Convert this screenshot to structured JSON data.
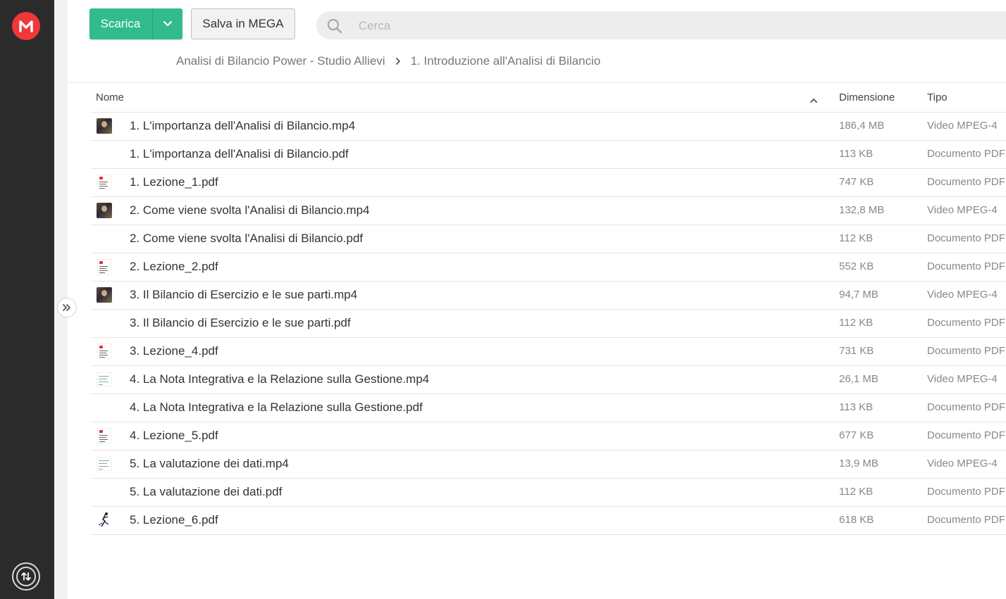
{
  "toolbar": {
    "download_label": "Scarica",
    "save_label": "Salva in MEGA",
    "search_placeholder": "Cerca"
  },
  "breadcrumb": [
    "Analisi di Bilancio Power - Studio Allievi",
    "1. Introduzione all'Analisi di Bilancio"
  ],
  "columns": {
    "name": "Nome",
    "size": "Dimensione",
    "type": "Tipo"
  },
  "files": [
    {
      "name": "1. L'importanza dell'Analisi di Bilancio.mp4",
      "size": "186,4 MB",
      "type": "Video MPEG-4",
      "thumb": "video-thumbnail"
    },
    {
      "name": "1. L'importanza dell'Analisi di Bilancio.pdf",
      "size": "113 KB",
      "type": "Documento PDF",
      "thumb": "none"
    },
    {
      "name": "1. Lezione_1.pdf",
      "size": "747 KB",
      "type": "Documento PDF",
      "thumb": "pdf-thumbnail"
    },
    {
      "name": "2. Come viene svolta l'Analisi di Bilancio.mp4",
      "size": "132,8 MB",
      "type": "Video MPEG-4",
      "thumb": "video-thumbnail"
    },
    {
      "name": "2. Come viene svolta l'Analisi di Bilancio.pdf",
      "size": "112 KB",
      "type": "Documento PDF",
      "thumb": "none"
    },
    {
      "name": "2. Lezione_2.pdf",
      "size": "552 KB",
      "type": "Documento PDF",
      "thumb": "pdf-thumbnail"
    },
    {
      "name": "3. Il Bilancio di Esercizio e le sue parti.mp4",
      "size": "94,7 MB",
      "type": "Video MPEG-4",
      "thumb": "video-thumbnail"
    },
    {
      "name": "3. Il Bilancio di Esercizio e le sue parti.pdf",
      "size": "112 KB",
      "type": "Documento PDF",
      "thumb": "none"
    },
    {
      "name": "3. Lezione_4.pdf",
      "size": "731 KB",
      "type": "Documento PDF",
      "thumb": "pdf-thumbnail"
    },
    {
      "name": "4. La Nota Integrativa e la Relazione sulla Gestione.mp4",
      "size": "26,1 MB",
      "type": "Video MPEG-4",
      "thumb": "document-thumbnail"
    },
    {
      "name": "4. La Nota Integrativa e la Relazione sulla Gestione.pdf",
      "size": "113 KB",
      "type": "Documento PDF",
      "thumb": "none"
    },
    {
      "name": "4. Lezione_5.pdf",
      "size": "677 KB",
      "type": "Documento PDF",
      "thumb": "pdf-thumbnail"
    },
    {
      "name": "5. La valutazione dei dati.mp4",
      "size": "13,9 MB",
      "type": "Video MPEG-4",
      "thumb": "document-thumbnail"
    },
    {
      "name": "5. La valutazione dei dati.pdf",
      "size": "112 KB",
      "type": "Documento PDF",
      "thumb": "none"
    },
    {
      "name": "5. Lezione_6.pdf",
      "size": "618 KB",
      "type": "Documento PDF",
      "thumb": "illustration-thumbnail"
    }
  ],
  "colors": {
    "brand_red": "#f0373a",
    "download_green": "#31bb8e",
    "sidebar_dark": "#2b2b2b"
  },
  "icons": {
    "logo": "mega-logo-icon",
    "transfers": "transfers-icon",
    "expand": "double-chevron-right-icon",
    "search": "search-icon",
    "dropdown": "chevron-down-icon",
    "breadcrumb_separator": "chevron-right-icon",
    "sort": "chevron-up-icon"
  }
}
